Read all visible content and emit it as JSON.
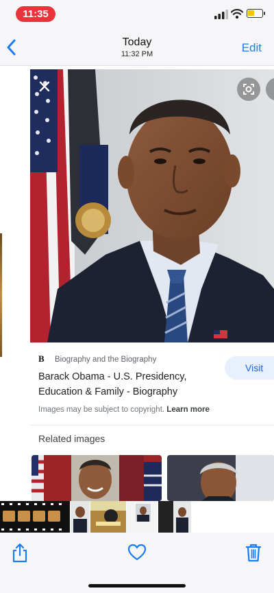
{
  "status_bar": {
    "time": "11:35",
    "signal_icon": "cellular-signal-icon",
    "wifi_icon": "wifi-icon",
    "battery_icon": "battery-icon",
    "battery_level": 0.45,
    "time_pill_color": "#e8343a",
    "battery_color": "#f2c500"
  },
  "nav": {
    "back_icon": "chevron-left-icon",
    "title": "Today",
    "subtitle": "11:32 PM",
    "edit_label": "Edit",
    "accent_color": "#1a7cf2"
  },
  "lens_result": {
    "close_icon": "close-icon",
    "lens_icon": "lens-icon",
    "source_logo": "B",
    "source_name": "Biography and the Biography",
    "visit_label": "Visit",
    "title": "Barack Obama - U.S. Presidency, Education & Family - Biography",
    "copyright_text": "Images may be subject to copyright.",
    "learn_more_label": "Learn more",
    "related_title": "Related images"
  },
  "toolbar": {
    "share_icon": "share-icon",
    "favorite_icon": "heart-icon",
    "delete_icon": "trash-icon"
  }
}
